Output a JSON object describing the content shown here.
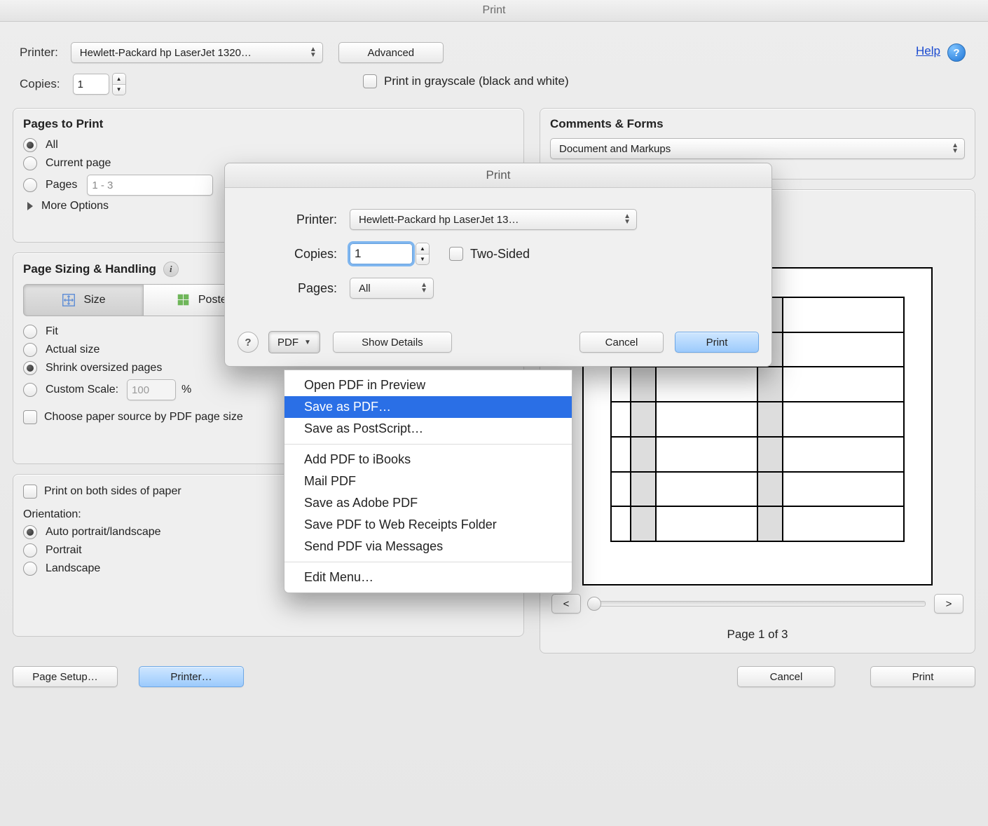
{
  "window": {
    "title": "Print",
    "help_link": "Help"
  },
  "top": {
    "printer_label": "Printer:",
    "printer_value": "Hewlett-Packard hp LaserJet 1320…",
    "advanced": "Advanced",
    "copies_label": "Copies:",
    "copies_value": "1",
    "grayscale": "Print in grayscale (black and white)"
  },
  "pages": {
    "title": "Pages to Print",
    "all": "All",
    "current": "Current page",
    "pages_label": "Pages",
    "pages_value": "1 - 3",
    "more": "More Options"
  },
  "comments": {
    "title": "Comments & Forms",
    "value": "Document and Markups"
  },
  "sizing": {
    "title": "Page Sizing & Handling",
    "size": "Size",
    "poster": "Poster",
    "fit": "Fit",
    "actual": "Actual size",
    "shrink": "Shrink oversized pages",
    "custom": "Custom Scale:",
    "custom_val": "100",
    "pct": "%",
    "paper_source": "Choose paper source by PDF page size",
    "both_sides": "Print on both sides of paper",
    "orientation": "Orientation:",
    "auto": "Auto portrait/landscape",
    "portrait": "Portrait",
    "landscape": "Landscape"
  },
  "preview": {
    "prev": "<",
    "next": ">",
    "page_status": "Page 1 of 3"
  },
  "footer": {
    "page_setup": "Page Setup…",
    "printer": "Printer…",
    "cancel": "Cancel",
    "print": "Print"
  },
  "sheet": {
    "title": "Print",
    "printer_label": "Printer:",
    "printer_value": "Hewlett-Packard hp LaserJet 13…",
    "copies_label": "Copies:",
    "copies_value": "1",
    "two_sided": "Two-Sided",
    "pages_label": "Pages:",
    "pages_value": "All",
    "pdf": "PDF",
    "show_details": "Show Details",
    "cancel": "Cancel",
    "print": "Print"
  },
  "menu": {
    "items_a": [
      "Open PDF in Preview",
      "Save as PDF…",
      "Save as PostScript…"
    ],
    "items_b": [
      "Add PDF to iBooks",
      "Mail PDF",
      "Save as Adobe PDF",
      "Save PDF to Web Receipts Folder",
      "Send PDF via Messages"
    ],
    "items_c": [
      "Edit Menu…"
    ],
    "selected": "Save as PDF…"
  }
}
